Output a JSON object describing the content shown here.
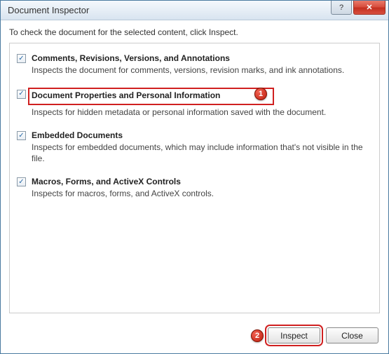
{
  "window": {
    "title": "Document Inspector"
  },
  "instruction": "To check the document for the selected content, click Inspect.",
  "options": [
    {
      "checked": true,
      "title": "Comments, Revisions, Versions, and Annotations",
      "desc": "Inspects the document for comments, versions, revision marks, and ink annotations."
    },
    {
      "checked": true,
      "title": "Document Properties and Personal Information",
      "desc": "Inspects for hidden metadata or personal information saved with the document."
    },
    {
      "checked": true,
      "title": "Embedded Documents",
      "desc": "Inspects for embedded documents, which may include information that's not visible in the file."
    },
    {
      "checked": true,
      "title": "Macros, Forms, and ActiveX Controls",
      "desc": "Inspects for macros, forms, and ActiveX controls."
    }
  ],
  "buttons": {
    "inspect": "Inspect",
    "close": "Close"
  },
  "callouts": {
    "one": "1",
    "two": "2"
  },
  "checkmark": "✓",
  "help_glyph": "?",
  "close_glyph": "✕"
}
